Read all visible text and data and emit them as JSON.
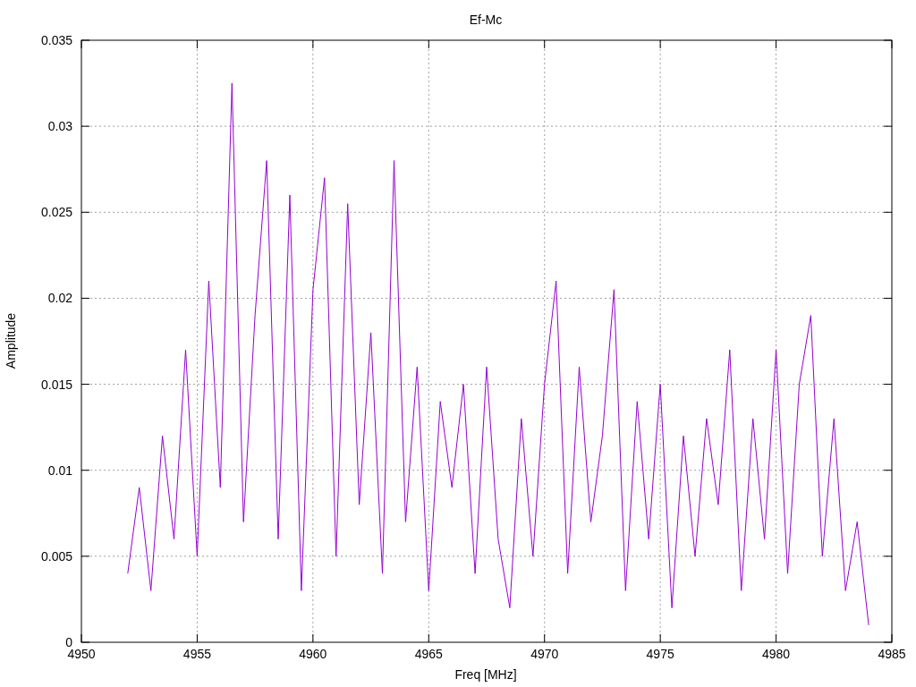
{
  "plot": {
    "chart_data": {
      "type": "line",
      "title": "Ef-Mc",
      "xlabel": "Freq [MHz]",
      "ylabel": "Amplitude",
      "grid": true,
      "xlim": [
        4950,
        4985
      ],
      "ylim": [
        0,
        0.035
      ],
      "xticks": [
        4950,
        4955,
        4960,
        4965,
        4970,
        4975,
        4980,
        4985
      ],
      "yticks": [
        0,
        0.005,
        0.01,
        0.015,
        0.02,
        0.025,
        0.03,
        0.035
      ],
      "x": [
        4952,
        4952.5,
        4953,
        4953.5,
        4954,
        4954.5,
        4955,
        4955.5,
        4956,
        4956.5,
        4957,
        4957.5,
        4958,
        4958.5,
        4959,
        4959.5,
        4960,
        4960.5,
        4961,
        4961.5,
        4962,
        4962.5,
        4963,
        4963.5,
        4964,
        4964.5,
        4965,
        4965.5,
        4966,
        4966.5,
        4967,
        4967.5,
        4968,
        4968.5,
        4969,
        4969.5,
        4970,
        4970.5,
        4971,
        4971.5,
        4972,
        4972.5,
        4973,
        4973.5,
        4974,
        4974.5,
        4975,
        4975.5,
        4976,
        4976.5,
        4977,
        4977.5,
        4978,
        4978.5,
        4979,
        4979.5,
        4980,
        4980.5,
        4981,
        4981.5,
        4982,
        4982.5,
        4983,
        4983.5,
        4984
      ],
      "series": [
        {
          "color": "#9400d3",
          "values": [
            0.004,
            0.009,
            0.003,
            0.012,
            0.006,
            0.017,
            0.005,
            0.021,
            0.009,
            0.0325,
            0.007,
            0.019,
            0.028,
            0.006,
            0.026,
            0.003,
            0.0205,
            0.027,
            0.005,
            0.0255,
            0.008,
            0.018,
            0.004,
            0.028,
            0.007,
            0.016,
            0.003,
            0.014,
            0.009,
            0.015,
            0.004,
            0.016,
            0.006,
            0.002,
            0.013,
            0.005,
            0.015,
            0.021,
            0.004,
            0.016,
            0.007,
            0.012,
            0.0205,
            0.003,
            0.014,
            0.006,
            0.015,
            0.002,
            0.012,
            0.005,
            0.013,
            0.008,
            0.017,
            0.003,
            0.013,
            0.006,
            0.017,
            0.004,
            0.015,
            0.019,
            0.005,
            0.013,
            0.003,
            0.007,
            0.001
          ]
        }
      ]
    }
  }
}
